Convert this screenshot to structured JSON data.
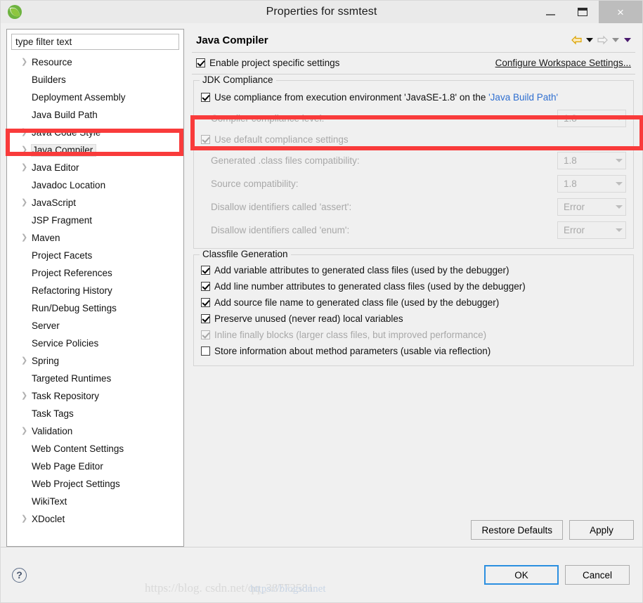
{
  "window": {
    "title": "Properties for ssmtest",
    "app_icon": "spring-leaf-icon",
    "minimize_label": "–",
    "maximize_label": "❐",
    "close_label": "×"
  },
  "sidebar": {
    "filter_placeholder": "type filter text",
    "items": [
      {
        "label": "Resource",
        "expandable": true,
        "selected": false
      },
      {
        "label": "Builders",
        "expandable": false,
        "selected": false
      },
      {
        "label": "Deployment Assembly",
        "expandable": false,
        "selected": false
      },
      {
        "label": "Java Build Path",
        "expandable": false,
        "selected": false
      },
      {
        "label": "Java Code Style",
        "expandable": true,
        "selected": false
      },
      {
        "label": "Java Compiler",
        "expandable": true,
        "selected": true
      },
      {
        "label": "Java Editor",
        "expandable": true,
        "selected": false
      },
      {
        "label": "Javadoc Location",
        "expandable": false,
        "selected": false
      },
      {
        "label": "JavaScript",
        "expandable": true,
        "selected": false
      },
      {
        "label": "JSP Fragment",
        "expandable": false,
        "selected": false
      },
      {
        "label": "Maven",
        "expandable": true,
        "selected": false
      },
      {
        "label": "Project Facets",
        "expandable": false,
        "selected": false
      },
      {
        "label": "Project References",
        "expandable": false,
        "selected": false
      },
      {
        "label": "Refactoring History",
        "expandable": false,
        "selected": false
      },
      {
        "label": "Run/Debug Settings",
        "expandable": false,
        "selected": false
      },
      {
        "label": "Server",
        "expandable": false,
        "selected": false
      },
      {
        "label": "Service Policies",
        "expandable": false,
        "selected": false
      },
      {
        "label": "Spring",
        "expandable": true,
        "selected": false
      },
      {
        "label": "Targeted Runtimes",
        "expandable": false,
        "selected": false
      },
      {
        "label": "Task Repository",
        "expandable": true,
        "selected": false
      },
      {
        "label": "Task Tags",
        "expandable": false,
        "selected": false
      },
      {
        "label": "Validation",
        "expandable": true,
        "selected": false
      },
      {
        "label": "Web Content Settings",
        "expandable": false,
        "selected": false
      },
      {
        "label": "Web Page Editor",
        "expandable": false,
        "selected": false
      },
      {
        "label": "Web Project Settings",
        "expandable": false,
        "selected": false
      },
      {
        "label": "WikiText",
        "expandable": false,
        "selected": false
      },
      {
        "label": "XDoclet",
        "expandable": true,
        "selected": false
      }
    ]
  },
  "page": {
    "title": "Java Compiler",
    "nav": {
      "back_icon": "back-arrow-icon",
      "back_dropdown_icon": "caret-down-icon",
      "forward_icon": "forward-arrow-icon",
      "forward_dropdown_icon": "caret-down-icon",
      "menu_icon": "caret-down-icon"
    },
    "enable_project_specific": {
      "label": "Enable project specific settings",
      "checked": true
    },
    "configure_workspace_link": "Configure Workspace Settings...",
    "jdk_compliance": {
      "group_title": "JDK Compliance",
      "use_execution_env": {
        "text_before": "Use compliance from execution environment 'JavaSE-1.8' on the ",
        "link": "'Java Build Path'",
        "checked": true
      },
      "compiler_compliance_level": {
        "label": "Compiler compliance level:",
        "value": "1.8",
        "disabled": true
      },
      "use_default_compliance": {
        "label": "Use default compliance settings",
        "checked": true,
        "disabled": true
      },
      "fields": [
        {
          "label": "Generated .class files compatibility:",
          "value": "1.8",
          "disabled": true
        },
        {
          "label": "Source compatibility:",
          "value": "1.8",
          "disabled": true
        },
        {
          "label": "Disallow identifiers called 'assert':",
          "value": "Error",
          "disabled": true
        },
        {
          "label": "Disallow identifiers called 'enum':",
          "value": "Error",
          "disabled": true
        }
      ]
    },
    "classfile_generation": {
      "group_title": "Classfile Generation",
      "options": [
        {
          "label": "Add variable attributes to generated class files (used by the debugger)",
          "checked": true,
          "disabled": false
        },
        {
          "label": "Add line number attributes to generated class files (used by the debugger)",
          "checked": true,
          "disabled": false
        },
        {
          "label": "Add source file name to generated class file (used by the debugger)",
          "checked": true,
          "disabled": false
        },
        {
          "label": "Preserve unused (never read) local variables",
          "checked": true,
          "disabled": false
        },
        {
          "label": "Inline finally blocks (larger class files, but improved performance)",
          "checked": true,
          "disabled": true
        },
        {
          "label": "Store information about method parameters (usable via reflection)",
          "checked": false,
          "disabled": false
        }
      ]
    },
    "restore_defaults_label": "Restore Defaults",
    "apply_label": "Apply"
  },
  "footer": {
    "help_icon": "question-mark-icon",
    "help_label": "?",
    "ok_label": "OK",
    "cancel_label": "Cancel"
  },
  "watermark": {
    "text": "https://blog. csdn.net/qq_38772581",
    "overlay": "https://blogsdnnet"
  },
  "colors": {
    "highlight_red": "#f93b3b",
    "link_blue": "#2f6fd0",
    "focus_blue": "#2b8fe0",
    "titlebar": "#eaeaea",
    "dialog_bg": "#f0f0f0"
  }
}
